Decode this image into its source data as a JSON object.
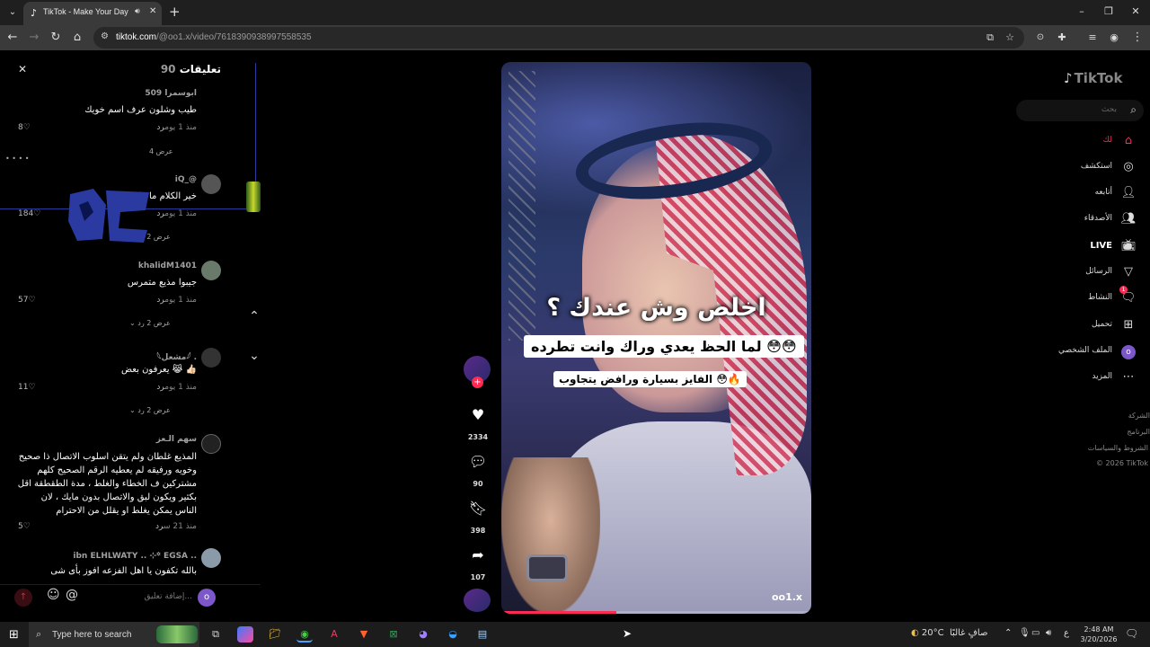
{
  "browser": {
    "tab_title": "TikTok - Make Your Day",
    "url_host": "tiktok.com",
    "url_path": "/@oo1.x/video/7618390938997558535"
  },
  "comments_panel": {
    "title": "تعليقات",
    "count": "90",
    "composer_placeholder": "إضافة تعليق...",
    "composer_avatar": "o",
    "items": [
      {
        "user": "ابوسمرا 509",
        "text": "طيب وشلون عرف اسم خويك",
        "time": "منذ 1 يوم",
        "reply": "رد",
        "likes": "8",
        "view_replies": "عرض 4"
      },
      {
        "user": "iQ_@",
        "text": "خير الكلام ما قل ودل",
        "time": "منذ 1 يوم",
        "reply": "رد",
        "likes": "184",
        "view_replies": "عرض 2 رد"
      },
      {
        "user": "khalidM1401",
        "text": "جيبوا مذيع متمرس",
        "time": "منذ 1 يوم",
        "reply": "رد",
        "likes": "57",
        "view_replies": "عرض 2 رد"
      },
      {
        "user": "𓆩مشعل𓆪 .",
        "text": "يعرفون بعض 😹 👍🏻",
        "time": "منذ 1 يوم",
        "reply": "رد",
        "likes": "11",
        "view_replies": "عرض 2 رد"
      },
      {
        "user": "سهم الـعز",
        "text": "المذيع غلطان ولم يتقن اسلوب الاتصال ذا صحيح وخويه ورفيقه لم يعطيه الرقم الصحيح كلهم مشتركين ف الخطاء والغلط ، مدة الطقطقة اقل بكثير ويكون لبق والاتصال بدون مايك ، لان الناس يمكن يغلط او يقلل من الاحترام",
        "time": "منذ 21 س",
        "reply": "رد",
        "likes": "5"
      },
      {
        "user": "ibn ELHLWATY .. ⊹꙳ EGSA ..",
        "text": "بالله تكفون يا اهل الفزعه افوز بأى شى",
        "time": "",
        "reply": "",
        "likes": ""
      }
    ]
  },
  "video": {
    "caption_main": "اخلص وش عندك ؟",
    "caption_second": "لما الحظ يعدي وراك وانت تطرده 😳😳",
    "caption_third": "الفايز بسيارة ورافض يتجاوب 😳🔥",
    "watermark": "oo1.x",
    "progress": 0.37
  },
  "actions": {
    "likes": "2334",
    "comments": "90",
    "saves": "398",
    "shares": "107",
    "follow": "+"
  },
  "sidebar": {
    "logo": "TikTok",
    "search_placeholder": "بحث",
    "nav": [
      {
        "label": "لك",
        "icon": "home-icon"
      },
      {
        "label": "استكشف",
        "icon": "compass-icon"
      },
      {
        "label": "أتابعه",
        "icon": "user-follow-icon"
      },
      {
        "label": "الأصدقاء",
        "icon": "friends-icon"
      },
      {
        "label": "LIVE",
        "icon": "live-icon"
      },
      {
        "label": "الرسائل",
        "icon": "send-icon"
      },
      {
        "label": "النشاط",
        "icon": "inbox-icon",
        "badge": "1"
      },
      {
        "label": "تحميل",
        "icon": "upload-icon"
      },
      {
        "label": "الملف الشخصي",
        "icon": "profile-icon",
        "avatar": "o"
      },
      {
        "label": "المزيد",
        "icon": "more-icon"
      }
    ],
    "footer": [
      "الشركة",
      "البرنامج",
      "الشروط والسياسات",
      "© 2026 TikTok"
    ]
  },
  "taskbar": {
    "search_placeholder": "Type here to search",
    "weather_temp": "20°C",
    "weather_text": "صافٍ غالبًا",
    "lang": "ع",
    "time": "2:48 AM",
    "date": "3/20/2026"
  }
}
